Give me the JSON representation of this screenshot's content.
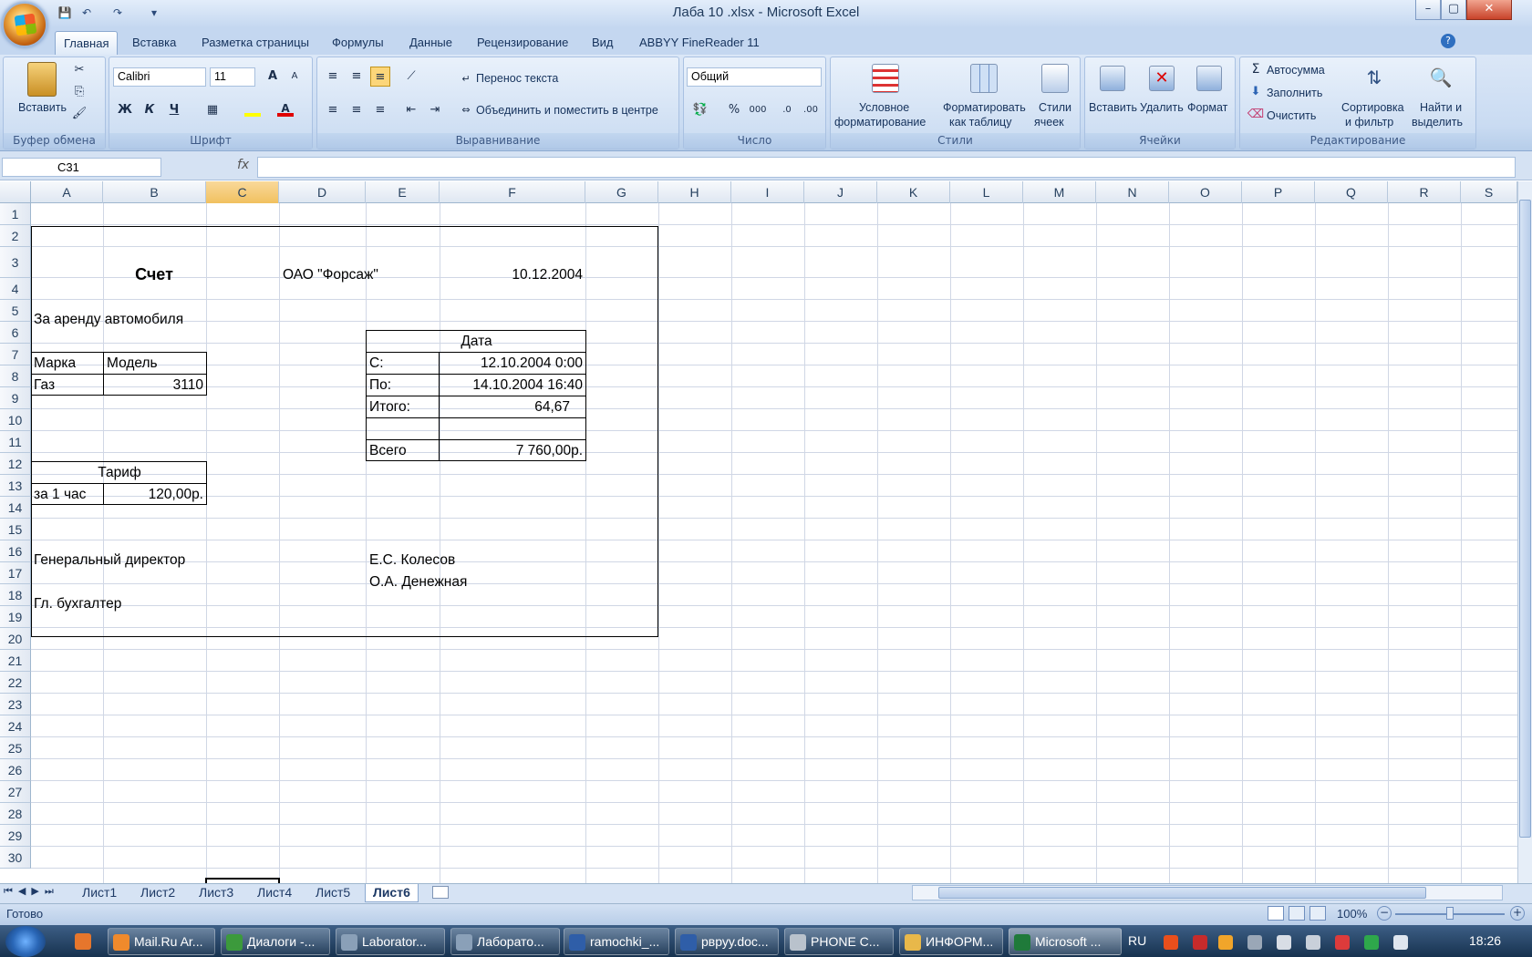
{
  "window": {
    "title": "Лаба 10 .xlsx - Microsoft Excel",
    "minimize": "–",
    "maximize": "▢",
    "close": "✕"
  },
  "ribbon_tabs": [
    "Главная",
    "Вставка",
    "Разметка страницы",
    "Формулы",
    "Данные",
    "Рецензирование",
    "Вид",
    "ABBYY FineReader 11"
  ],
  "clipboard": {
    "paste": "Вставить",
    "group": "Буфер обмена"
  },
  "font": {
    "name": "Calibri",
    "size": "11",
    "grow": "A",
    "shrink": "A",
    "bold": "Ж",
    "italic": "К",
    "underline": "Ч",
    "group": "Шрифт"
  },
  "alignment": {
    "wrap": "Перенос текста",
    "merge": "Объединить и поместить в центре",
    "group": "Выравнивание"
  },
  "number": {
    "format": "Общий",
    "percent": "%",
    "thousands": "000",
    "group": "Число"
  },
  "styles": {
    "conditional": "Условное",
    "conditional2": "форматирование",
    "astable": "Форматировать",
    "astable2": "как таблицу",
    "cellstyles": "Стили",
    "cellstyles2": "ячеек",
    "group": "Стили"
  },
  "cells": {
    "insert": "Вставить",
    "delete": "Удалить",
    "format": "Формат",
    "group": "Ячейки"
  },
  "editing": {
    "autosum": "Автосумма",
    "fill": "Заполнить",
    "clear": "Очистить",
    "sort": "Сортировка",
    "sort2": "и фильтр",
    "find": "Найти и",
    "find2": "выделить",
    "group": "Редактирование"
  },
  "formula_bar": {
    "name_box": "C31",
    "fx": "fx",
    "content": ""
  },
  "columns": [
    "A",
    "B",
    "C",
    "D",
    "E",
    "F",
    "G",
    "H",
    "I",
    "J",
    "K",
    "L",
    "M",
    "N",
    "O",
    "P",
    "Q",
    "R",
    "S"
  ],
  "rows": [
    "1",
    "2",
    "3",
    "4",
    "5",
    "6",
    "7",
    "8",
    "9",
    "10",
    "11",
    "12",
    "13",
    "14",
    "15",
    "16",
    "17",
    "18",
    "19",
    "20",
    "21",
    "22",
    "23",
    "24",
    "25",
    "26",
    "27",
    "28",
    "29",
    "30"
  ],
  "sheet": {
    "title": "Счет",
    "company": "ОАО \"Форсаж\"",
    "date": "10.12.2004",
    "subject": "За аренду автомобиля",
    "h_brand": "Марка",
    "h_model": "Модель",
    "brand": "Газ",
    "model": "3110",
    "h_tariff": "Тариф",
    "tariff_label": "за 1 час",
    "tariff_value": "120,00р.",
    "h_date": "Дата",
    "from_label": "С:",
    "from_value": "12.10.2004 0:00",
    "to_label": "По:",
    "to_value": "14.10.2004 16:40",
    "total_label": "Итого:",
    "total_value": "64,67",
    "sum_label": "Всего",
    "sum_value": "7 760,00р.",
    "director_title": "Генеральный директор",
    "director_name": "Е.С. Колесов",
    "accountant_name": "О.А. Денежная",
    "accountant_title": "Гл. бухгалтер"
  },
  "sheet_tabs": [
    "Лист1",
    "Лист2",
    "Лист3",
    "Лист4",
    "Лист5",
    "Лист6"
  ],
  "active_sheet": "Лист6",
  "status": {
    "ready": "Готово",
    "zoom": "100%"
  },
  "taskbar": {
    "items": [
      "Mail.Ru Ar...",
      "Диалоги -...",
      "Laborator...",
      "Лаборато...",
      "ramochki_...",
      "рвруу.doc...",
      "PHONE C...",
      "ИНФОРМ...",
      "Microsoft ..."
    ],
    "lang": "RU",
    "time": "18:26"
  },
  "colors": {
    "accent": "#1e395b",
    "ribbon": "#c9dbf2",
    "grid": "#d0d7e5"
  }
}
